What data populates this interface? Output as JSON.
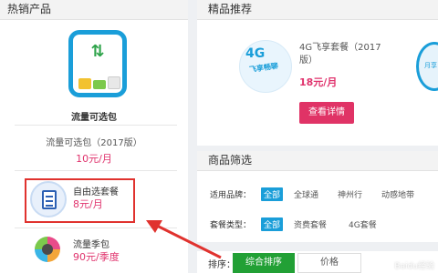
{
  "left_panel": {
    "header": "热销产品",
    "featured": {
      "name": "流量可选包",
      "subtitle": "流量可选包（2017版）",
      "price": "10元/月"
    },
    "items": [
      {
        "title": "自由选套餐",
        "price": "8元/月"
      },
      {
        "title": "流量季包",
        "price": "90元/季度"
      }
    ]
  },
  "recommend": {
    "header": "精品推荐",
    "product": {
      "image_text_big": "4G",
      "image_text_mid": "飞享畅聊",
      "title": "4G飞享套餐（2017版）",
      "price": "18元/月",
      "button": "查看详情"
    },
    "edge_image_text": "月享"
  },
  "filter": {
    "header": "商品筛选",
    "brand_label": "适用品牌：",
    "brands": [
      "全部",
      "全球通",
      "神州行",
      "动感地带"
    ],
    "type_label": "套餐类型：",
    "types": [
      "全部",
      "资费套餐",
      "4G套餐"
    ]
  },
  "sort": {
    "label": "排序：",
    "options": [
      "综合排序",
      "价格"
    ]
  },
  "watermark": "Baidu经验",
  "colors": {
    "accent_blue": "#1a9ed9",
    "price_pink": "#e0336d",
    "active_green": "#22a035",
    "highlight_red": "#e0322e"
  }
}
